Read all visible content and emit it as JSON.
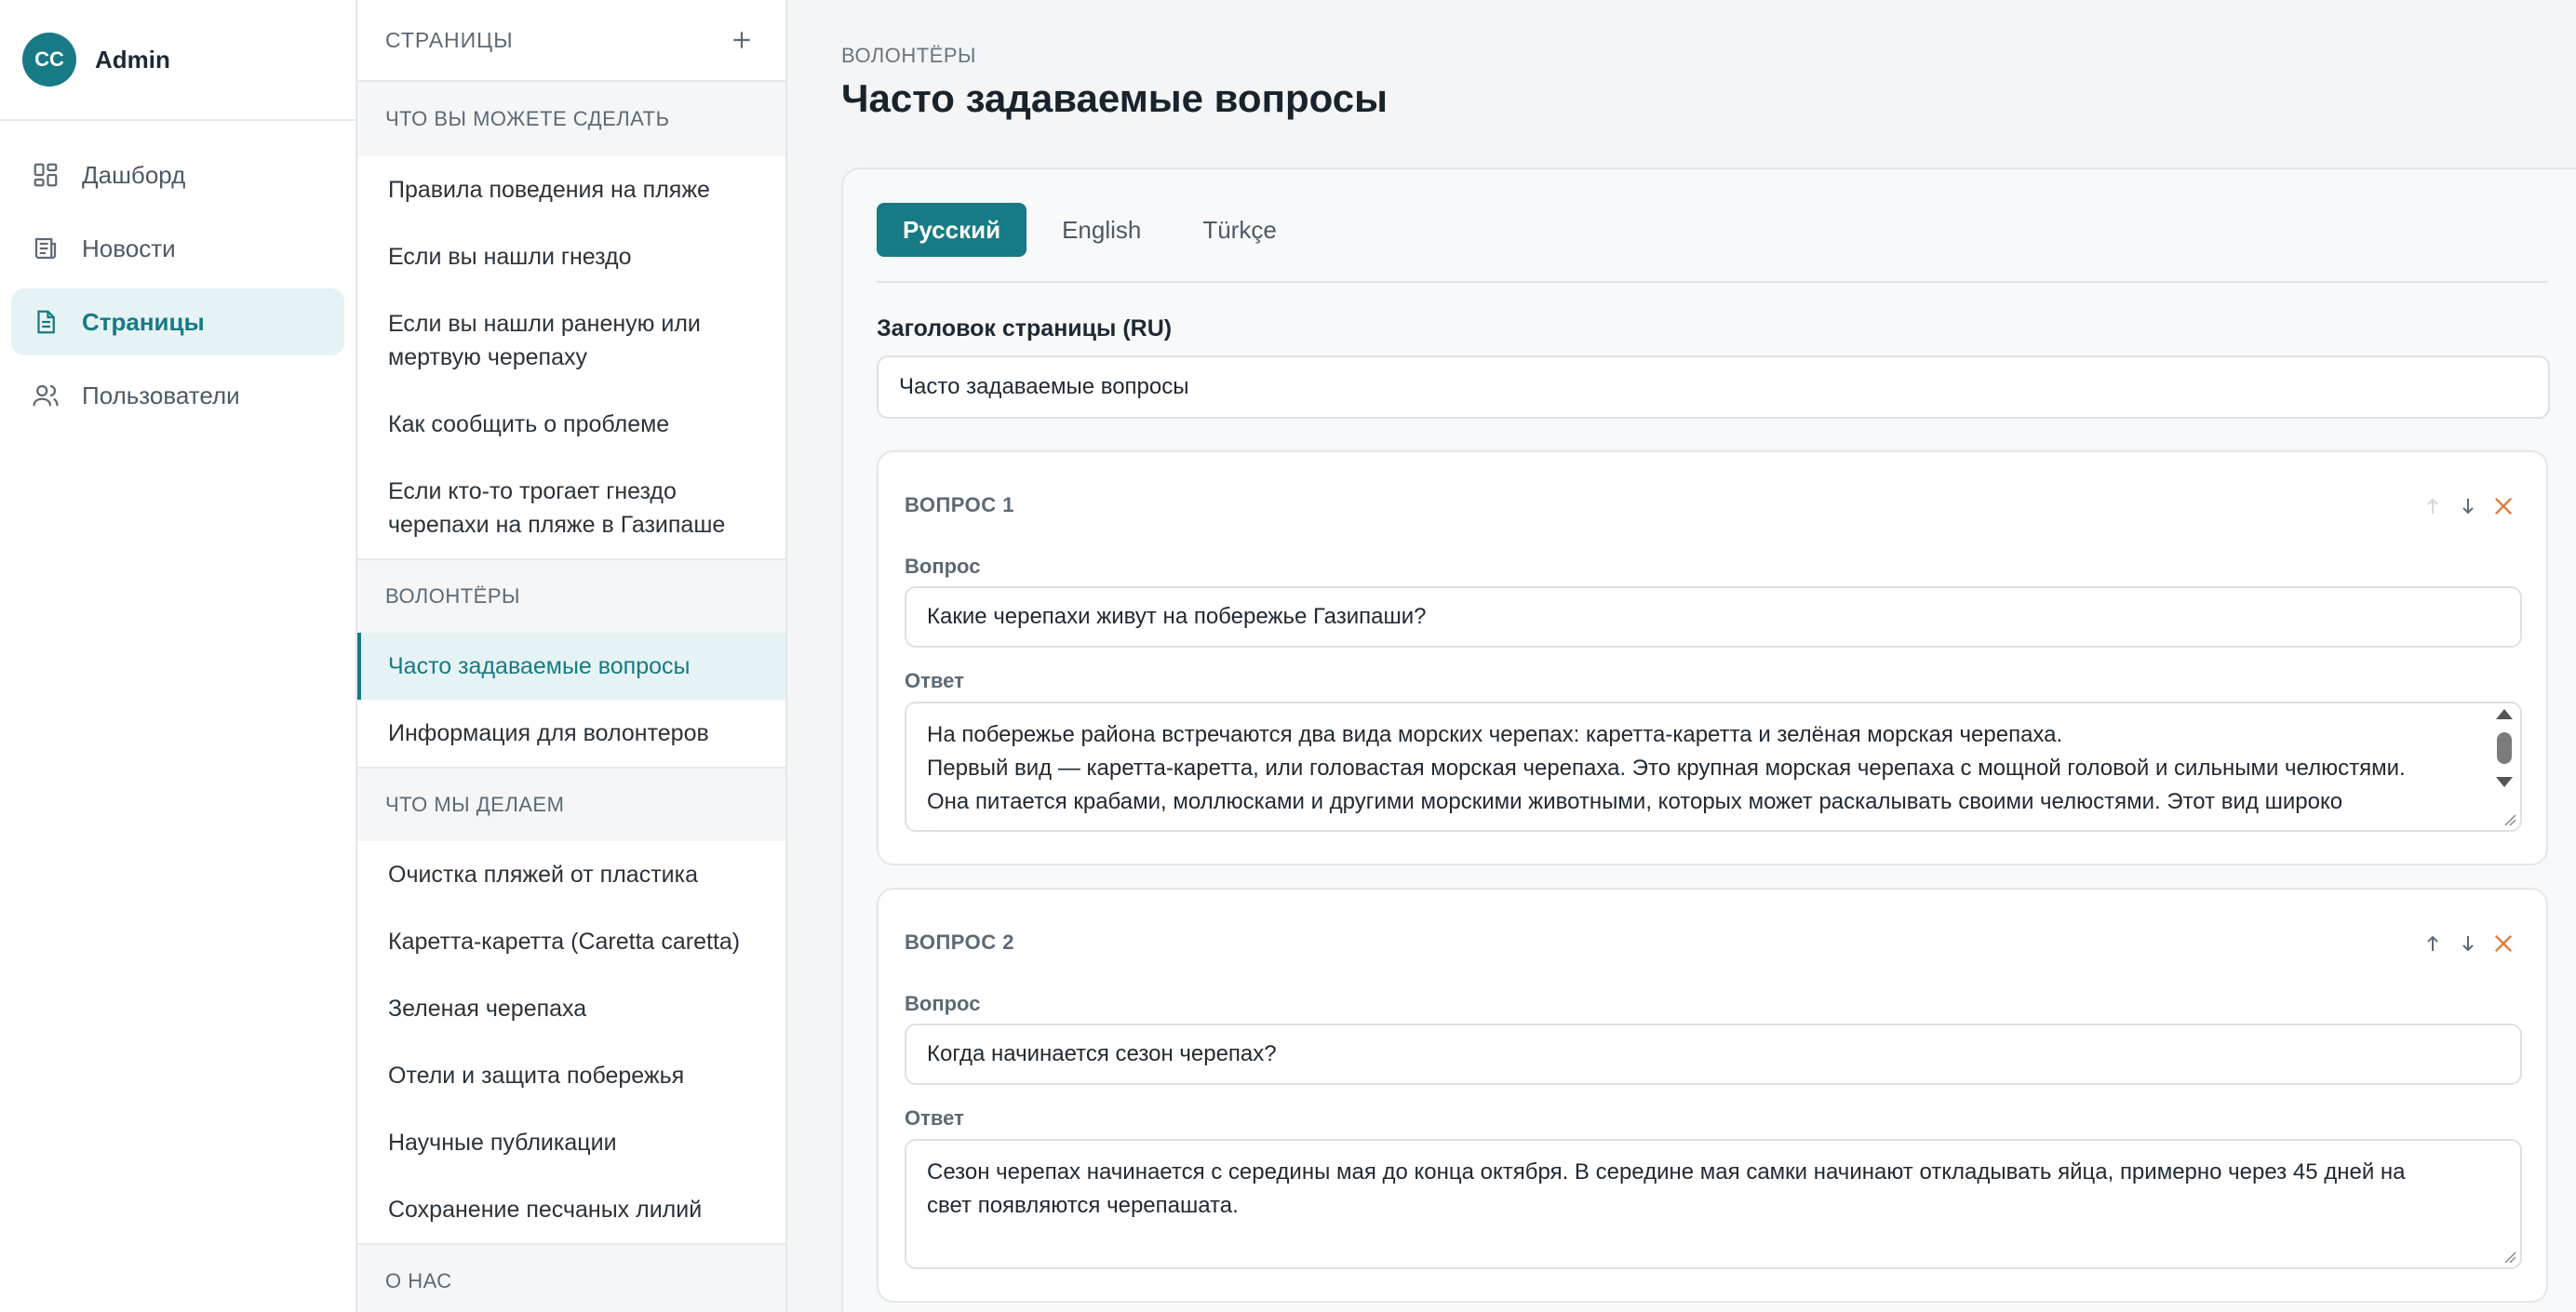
{
  "user": {
    "initials": "CC",
    "name": "Admin"
  },
  "nav": {
    "items": [
      {
        "label": "Дашборд",
        "icon": "dashboard-icon"
      },
      {
        "label": "Новости",
        "icon": "newspaper-icon"
      },
      {
        "label": "Страницы",
        "icon": "document-icon",
        "active": true
      },
      {
        "label": "Пользователи",
        "icon": "users-icon"
      }
    ]
  },
  "pages_panel": {
    "title": "СТРАНИЦЫ",
    "groups": [
      {
        "title": "ЧТО ВЫ МОЖЕТЕ СДЕЛАТЬ",
        "items": [
          "Правила поведения на пляже",
          "Если вы нашли гнездо",
          "Если вы нашли раненую или мертвую черепаху",
          "Как сообщить о проблеме",
          "Если кто-то трогает гнездо черепахи на пляже в Газипаше"
        ]
      },
      {
        "title": "ВОЛОНТЁРЫ",
        "items": [
          "Часто задаваемые вопросы",
          "Информация для волонтеров"
        ]
      },
      {
        "title": "ЧТО МЫ ДЕЛАЕМ",
        "items": [
          "Очистка пляжей от пластика",
          "Каретта-каретта (Caretta caretta)",
          "Зеленая черепаха",
          "Отели и защита побережья",
          "Научные публикации",
          "Сохранение песчаных лилий"
        ]
      },
      {
        "title": "О НАС",
        "items": []
      }
    ]
  },
  "main": {
    "breadcrumb": "ВОЛОНТЁРЫ",
    "title": "Часто задаваемые вопросы",
    "tabs": [
      "Русский",
      "English",
      "Türkçe"
    ],
    "page_title_label": "Заголовок страницы (RU)",
    "page_title_value": "Часто задаваемые вопросы",
    "question_label": "Вопрос",
    "answer_label": "Ответ",
    "questions": [
      {
        "heading": "ВОПРОС 1",
        "question": "Какие черепахи живут на побережье Газипаши?",
        "answer_lines": [
          "На побережье района встречаются два вида морских черепах: каретта-каретта и зелёная морская черепаха.",
          "Первый вид — каретта-каретта, или головастая морская черепаха. Это крупная морская черепаха с мощной головой и сильными челюстями.",
          "Она питается крабами, моллюсками и другими морскими животными, которых может раскалывать своими челюстями. Этот вид широко"
        ]
      },
      {
        "heading": "ВОПРОС 2",
        "question": "Когда начинается сезон черепах?",
        "answer_lines": [
          "Сезон черепах начинается с середины мая до конца октября. В середине мая самки начинают откладывать яйца, примерно через 45 дней на",
          "свет появляются черепашата."
        ]
      }
    ]
  },
  "colors": {
    "accent": "#177a84",
    "delete": "#e07a3a"
  }
}
